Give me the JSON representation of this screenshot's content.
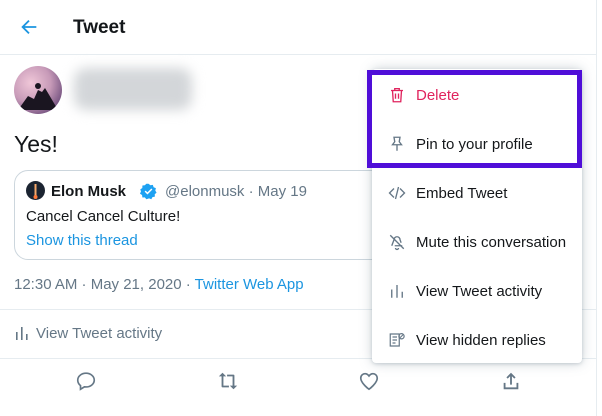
{
  "header": {
    "title": "Tweet"
  },
  "tweet": {
    "text": "Yes!",
    "timestamp": "12:30 AM · May 21, 2020 · ",
    "source": "Twitter Web App",
    "activity_label": "View Tweet activity"
  },
  "quoted": {
    "name": "Elon Musk",
    "handle": "@elonmusk · May 19",
    "text": "Cancel Cancel Culture!",
    "thread_link": "Show this thread"
  },
  "menu": {
    "items": [
      {
        "label": "Delete",
        "icon": "trash-icon",
        "color": "#e0245e"
      },
      {
        "label": "Pin to your profile",
        "icon": "pin-icon"
      },
      {
        "label": "Embed Tweet",
        "icon": "code-icon"
      },
      {
        "label": "Mute this conversation",
        "icon": "mute-icon"
      },
      {
        "label": "View Tweet activity",
        "icon": "activity-icon"
      },
      {
        "label": "View hidden replies",
        "icon": "hidden-replies-icon"
      }
    ]
  },
  "colors": {
    "accent": "#1b95e0",
    "danger": "#e0245e",
    "highlight": "#4f0ed8",
    "muted": "#657786"
  }
}
